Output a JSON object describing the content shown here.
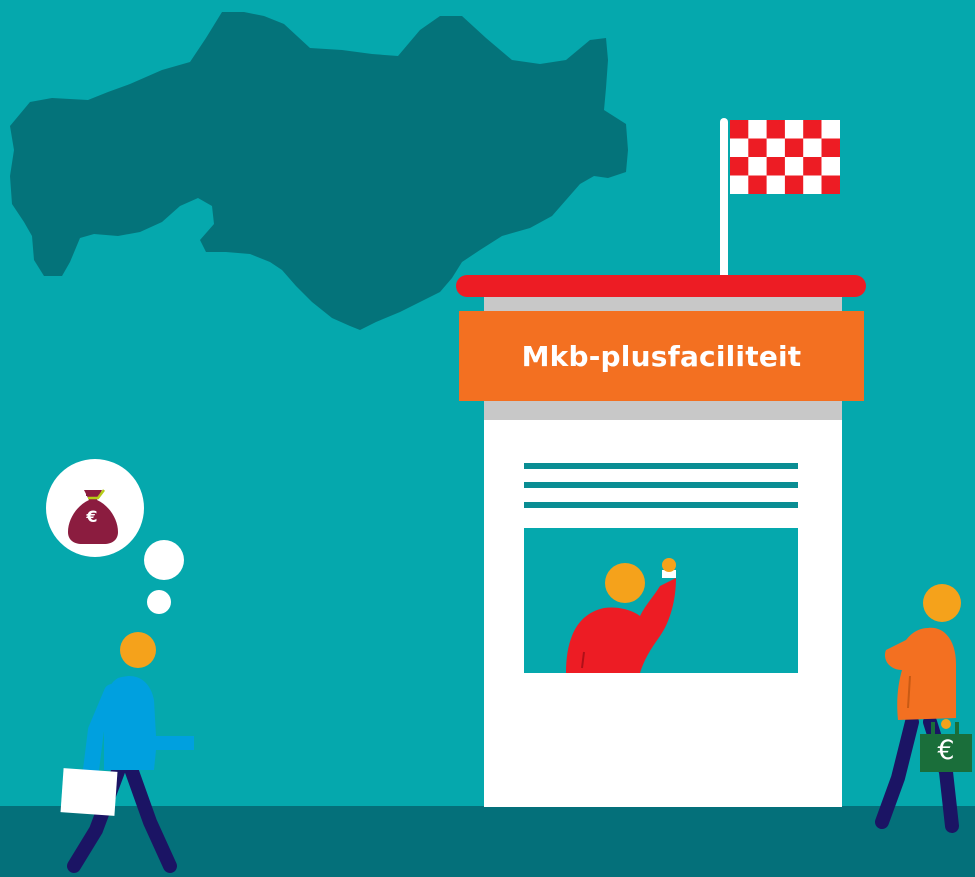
{
  "sign": {
    "label": "Mkb-plusfaciliteit"
  },
  "money_bag": {
    "symbol": "€"
  },
  "briefcase": {
    "symbol": "€"
  },
  "colors": {
    "sky": "#05a8ad",
    "ground": "#04707a",
    "map_region": "#04737a",
    "sign_orange": "#f37021",
    "roof_red": "#ed1c24",
    "flag_red": "#ed1c24",
    "skin_orange": "#f5a21b",
    "person_blue": "#00a0df",
    "trousers_navy": "#1b1464",
    "bag_burgundy": "#8b1c3f",
    "case_green": "#1a6e3a"
  },
  "icons": [
    "thought-bubble-icon",
    "money-bag-icon",
    "checkered-flag-icon",
    "briefcase-icon"
  ]
}
